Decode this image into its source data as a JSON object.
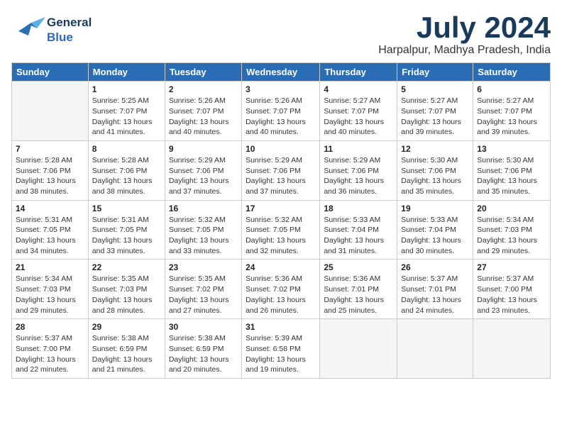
{
  "logo": {
    "line1": "General",
    "line2": "Blue"
  },
  "header": {
    "month": "July 2024",
    "location": "Harpalpur, Madhya Pradesh, India"
  },
  "weekdays": [
    "Sunday",
    "Monday",
    "Tuesday",
    "Wednesday",
    "Thursday",
    "Friday",
    "Saturday"
  ],
  "weeks": [
    [
      {
        "day": "",
        "info": ""
      },
      {
        "day": "1",
        "info": "Sunrise: 5:25 AM\nSunset: 7:07 PM\nDaylight: 13 hours\nand 41 minutes."
      },
      {
        "day": "2",
        "info": "Sunrise: 5:26 AM\nSunset: 7:07 PM\nDaylight: 13 hours\nand 40 minutes."
      },
      {
        "day": "3",
        "info": "Sunrise: 5:26 AM\nSunset: 7:07 PM\nDaylight: 13 hours\nand 40 minutes."
      },
      {
        "day": "4",
        "info": "Sunrise: 5:27 AM\nSunset: 7:07 PM\nDaylight: 13 hours\nand 40 minutes."
      },
      {
        "day": "5",
        "info": "Sunrise: 5:27 AM\nSunset: 7:07 PM\nDaylight: 13 hours\nand 39 minutes."
      },
      {
        "day": "6",
        "info": "Sunrise: 5:27 AM\nSunset: 7:07 PM\nDaylight: 13 hours\nand 39 minutes."
      }
    ],
    [
      {
        "day": "7",
        "info": "Sunrise: 5:28 AM\nSunset: 7:06 PM\nDaylight: 13 hours\nand 38 minutes."
      },
      {
        "day": "8",
        "info": "Sunrise: 5:28 AM\nSunset: 7:06 PM\nDaylight: 13 hours\nand 38 minutes."
      },
      {
        "day": "9",
        "info": "Sunrise: 5:29 AM\nSunset: 7:06 PM\nDaylight: 13 hours\nand 37 minutes."
      },
      {
        "day": "10",
        "info": "Sunrise: 5:29 AM\nSunset: 7:06 PM\nDaylight: 13 hours\nand 37 minutes."
      },
      {
        "day": "11",
        "info": "Sunrise: 5:29 AM\nSunset: 7:06 PM\nDaylight: 13 hours\nand 36 minutes."
      },
      {
        "day": "12",
        "info": "Sunrise: 5:30 AM\nSunset: 7:06 PM\nDaylight: 13 hours\nand 35 minutes."
      },
      {
        "day": "13",
        "info": "Sunrise: 5:30 AM\nSunset: 7:06 PM\nDaylight: 13 hours\nand 35 minutes."
      }
    ],
    [
      {
        "day": "14",
        "info": "Sunrise: 5:31 AM\nSunset: 7:05 PM\nDaylight: 13 hours\nand 34 minutes."
      },
      {
        "day": "15",
        "info": "Sunrise: 5:31 AM\nSunset: 7:05 PM\nDaylight: 13 hours\nand 33 minutes."
      },
      {
        "day": "16",
        "info": "Sunrise: 5:32 AM\nSunset: 7:05 PM\nDaylight: 13 hours\nand 33 minutes."
      },
      {
        "day": "17",
        "info": "Sunrise: 5:32 AM\nSunset: 7:05 PM\nDaylight: 13 hours\nand 32 minutes."
      },
      {
        "day": "18",
        "info": "Sunrise: 5:33 AM\nSunset: 7:04 PM\nDaylight: 13 hours\nand 31 minutes."
      },
      {
        "day": "19",
        "info": "Sunrise: 5:33 AM\nSunset: 7:04 PM\nDaylight: 13 hours\nand 30 minutes."
      },
      {
        "day": "20",
        "info": "Sunrise: 5:34 AM\nSunset: 7:03 PM\nDaylight: 13 hours\nand 29 minutes."
      }
    ],
    [
      {
        "day": "21",
        "info": "Sunrise: 5:34 AM\nSunset: 7:03 PM\nDaylight: 13 hours\nand 29 minutes."
      },
      {
        "day": "22",
        "info": "Sunrise: 5:35 AM\nSunset: 7:03 PM\nDaylight: 13 hours\nand 28 minutes."
      },
      {
        "day": "23",
        "info": "Sunrise: 5:35 AM\nSunset: 7:02 PM\nDaylight: 13 hours\nand 27 minutes."
      },
      {
        "day": "24",
        "info": "Sunrise: 5:36 AM\nSunset: 7:02 PM\nDaylight: 13 hours\nand 26 minutes."
      },
      {
        "day": "25",
        "info": "Sunrise: 5:36 AM\nSunset: 7:01 PM\nDaylight: 13 hours\nand 25 minutes."
      },
      {
        "day": "26",
        "info": "Sunrise: 5:37 AM\nSunset: 7:01 PM\nDaylight: 13 hours\nand 24 minutes."
      },
      {
        "day": "27",
        "info": "Sunrise: 5:37 AM\nSunset: 7:00 PM\nDaylight: 13 hours\nand 23 minutes."
      }
    ],
    [
      {
        "day": "28",
        "info": "Sunrise: 5:37 AM\nSunset: 7:00 PM\nDaylight: 13 hours\nand 22 minutes."
      },
      {
        "day": "29",
        "info": "Sunrise: 5:38 AM\nSunset: 6:59 PM\nDaylight: 13 hours\nand 21 minutes."
      },
      {
        "day": "30",
        "info": "Sunrise: 5:38 AM\nSunset: 6:59 PM\nDaylight: 13 hours\nand 20 minutes."
      },
      {
        "day": "31",
        "info": "Sunrise: 5:39 AM\nSunset: 6:58 PM\nDaylight: 13 hours\nand 19 minutes."
      },
      {
        "day": "",
        "info": ""
      },
      {
        "day": "",
        "info": ""
      },
      {
        "day": "",
        "info": ""
      }
    ]
  ]
}
